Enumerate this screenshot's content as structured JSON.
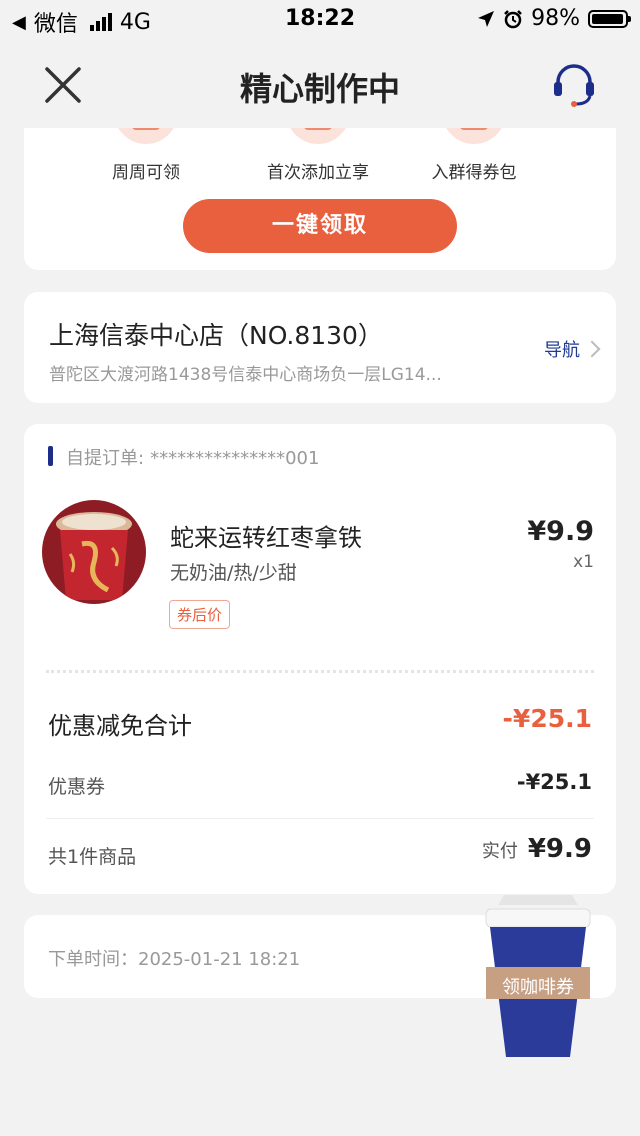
{
  "status_bar": {
    "back_app": "微信",
    "network": "4G",
    "time": "18:22",
    "battery_percent": "98%"
  },
  "header": {
    "title": "精心制作中"
  },
  "promo": {
    "items": [
      "周周可领",
      "首次添加立享",
      "入群得券包"
    ],
    "claim_button": "一键领取"
  },
  "store": {
    "name": "上海信泰中心店（NO.8130）",
    "address": "普陀区大渡河路1438号信泰中心商场负一层LG14...",
    "navigate_label": "导航"
  },
  "order": {
    "type_label": "自提订单:",
    "order_number": "***************001",
    "item": {
      "name": "蛇来运转红枣拿铁",
      "spec": "无奶油/热/少甜",
      "tag": "券后价",
      "price": "¥9.9",
      "qty": "x1"
    },
    "discount_total_label": "优惠减免合计",
    "discount_total_value": "-¥25.1",
    "coupon_label": "优惠券",
    "coupon_value": "-¥25.1",
    "item_count_label": "共1件商品",
    "paid_label": "实付",
    "paid_value": "¥9.9"
  },
  "order_time": {
    "label": "下单时间：",
    "value": "2025-01-21 18:21"
  },
  "floating_coupon": {
    "label": "领咖啡券"
  },
  "colors": {
    "accent": "#e9603f",
    "brand_blue": "#1c2d8a",
    "background": "#f2f2f2"
  }
}
